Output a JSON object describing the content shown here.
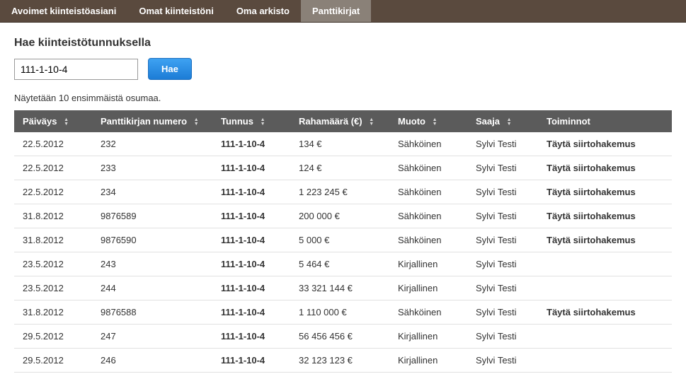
{
  "nav": {
    "tabs": [
      {
        "label": "Avoimet kiinteistöasiani",
        "active": false
      },
      {
        "label": "Omat kiinteistöni",
        "active": false
      },
      {
        "label": "Oma arkisto",
        "active": false
      },
      {
        "label": "Panttikirjat",
        "active": true
      }
    ]
  },
  "search": {
    "label": "Hae kiinteistötunnuksella",
    "value": "111-1-10-4",
    "button": "Hae"
  },
  "resultsNote": "Näytetään 10 ensimmäistä osumaa.",
  "table": {
    "headers": {
      "date": "Päiväys",
      "number": "Panttikirjan numero",
      "tunnus": "Tunnus",
      "amount": "Rahamäärä (€)",
      "muoto": "Muoto",
      "saaja": "Saaja",
      "toiminnot": "Toiminnot"
    },
    "actionLabel": "Täytä siirtohakemus",
    "rows": [
      {
        "date": "22.5.2012",
        "number": "232",
        "tunnus": "111-1-10-4",
        "amount": "134 €",
        "muoto": "Sähköinen",
        "saaja": "Sylvi Testi",
        "action": true
      },
      {
        "date": "22.5.2012",
        "number": "233",
        "tunnus": "111-1-10-4",
        "amount": "124 €",
        "muoto": "Sähköinen",
        "saaja": "Sylvi Testi",
        "action": true
      },
      {
        "date": "22.5.2012",
        "number": "234",
        "tunnus": "111-1-10-4",
        "amount": "1 223 245 €",
        "muoto": "Sähköinen",
        "saaja": "Sylvi Testi",
        "action": true
      },
      {
        "date": "31.8.2012",
        "number": "9876589",
        "tunnus": "111-1-10-4",
        "amount": "200 000 €",
        "muoto": "Sähköinen",
        "saaja": "Sylvi Testi",
        "action": true
      },
      {
        "date": "31.8.2012",
        "number": "9876590",
        "tunnus": "111-1-10-4",
        "amount": "5 000 €",
        "muoto": "Sähköinen",
        "saaja": "Sylvi Testi",
        "action": true
      },
      {
        "date": "23.5.2012",
        "number": "243",
        "tunnus": "111-1-10-4",
        "amount": "5 464 €",
        "muoto": "Kirjallinen",
        "saaja": "Sylvi Testi",
        "action": false
      },
      {
        "date": "23.5.2012",
        "number": "244",
        "tunnus": "111-1-10-4",
        "amount": "33 321 144 €",
        "muoto": "Kirjallinen",
        "saaja": "Sylvi Testi",
        "action": false
      },
      {
        "date": "31.8.2012",
        "number": "9876588",
        "tunnus": "111-1-10-4",
        "amount": "1 110 000 €",
        "muoto": "Sähköinen",
        "saaja": "Sylvi Testi",
        "action": true
      },
      {
        "date": "29.5.2012",
        "number": "247",
        "tunnus": "111-1-10-4",
        "amount": "56 456 456 €",
        "muoto": "Kirjallinen",
        "saaja": "Sylvi Testi",
        "action": false
      },
      {
        "date": "29.5.2012",
        "number": "246",
        "tunnus": "111-1-10-4",
        "amount": "32 123 123 €",
        "muoto": "Kirjallinen",
        "saaja": "Sylvi Testi",
        "action": false
      }
    ]
  }
}
